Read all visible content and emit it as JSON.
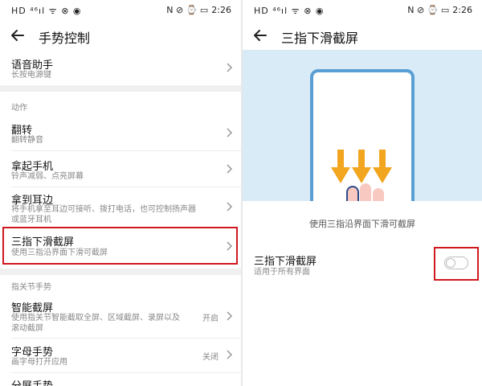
{
  "status": {
    "left_icons": "HD ⁴⁶ıl ᯤ ⊗ ◉",
    "right_icons": "N ⊘ ⌚ ▭",
    "time": "2:26"
  },
  "left": {
    "title": "手势控制",
    "voice": {
      "title": "语音助手",
      "subtitle": "长按电源键"
    },
    "section_actions": "动作",
    "flip": {
      "title": "翻转",
      "subtitle": "翻转静音"
    },
    "pickup": {
      "title": "拿起手机",
      "subtitle": "铃声减弱、点亮屏幕"
    },
    "ear": {
      "title": "拿到耳边",
      "subtitle_line1": "将手机拿至耳边可接听、拨打电话，也可控制扬声器",
      "subtitle_line2": "或蓝牙耳机"
    },
    "three_finger": {
      "title": "三指下滑截屏",
      "subtitle": "使用三指沿界面下滑可截屏"
    },
    "section_knuckle": "指关节手势",
    "smart_shot": {
      "title": "智能截屏",
      "subtitle_line1": "使用指关节智能截取全屏、区域截屏、录屏以及",
      "subtitle_line2": "滚动截屏",
      "value": "开启"
    },
    "letter": {
      "title": "字母手势",
      "subtitle": "画字母打开应用",
      "value": "关闭"
    },
    "split": {
      "title": "分屏手势"
    }
  },
  "right": {
    "title": "三指下滑截屏",
    "caption": "使用三指沿界面下滑可截屏",
    "setting": {
      "title": "三指下滑截屏",
      "subtitle": "适用于所有界面"
    },
    "toggle_on": false
  },
  "colors": {
    "highlight": "#d0191f",
    "illustration_bg": "#d9ebf7",
    "phone_outline": "#5a9fd4",
    "arrow": "#f2a51e",
    "finger": "#f7c9c0"
  },
  "icons": {
    "back": "arrow-left",
    "chevron": "chevron-right"
  }
}
